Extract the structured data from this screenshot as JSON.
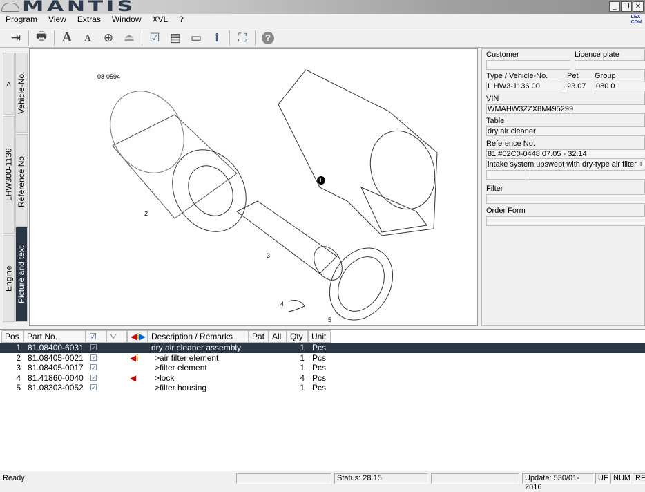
{
  "app": {
    "title": "MANTIS",
    "man_logo": "MAN",
    "lexcom": "LEX COM"
  },
  "window_buttons": [
    "_",
    "❐",
    "✕"
  ],
  "menu": [
    "Program",
    "View",
    "Extras",
    "Window",
    "XVL",
    "?"
  ],
  "toolbar": [
    {
      "icon": "exit-icon",
      "glyph": "⇥"
    },
    {
      "icon": "printer-icon",
      "glyph": "🖶"
    },
    {
      "icon": "font-large-icon",
      "glyph": "A"
    },
    {
      "icon": "font-small-icon",
      "glyph": "A"
    },
    {
      "icon": "zoom-in-icon",
      "glyph": "⊕"
    },
    {
      "icon": "stamp-icon",
      "glyph": "⏏"
    },
    {
      "icon": "checklist-icon",
      "glyph": "☑"
    },
    {
      "icon": "document-icon",
      "glyph": "▤"
    },
    {
      "icon": "folder-icon",
      "glyph": "▭"
    },
    {
      "icon": "info-flashlight-icon",
      "glyph": "i"
    },
    {
      "icon": "fullscreen-icon",
      "glyph": "⛶"
    },
    {
      "icon": "help-icon",
      "glyph": "?"
    }
  ],
  "tabs": {
    "outer": [
      ">",
      "LHW300-1136",
      "Engine"
    ],
    "inner": [
      "Vehicle-No.",
      "Reference No.",
      "Picture and text"
    ]
  },
  "drawing": {
    "id": "08-0594",
    "callouts": [
      "1",
      "2",
      "3",
      "4",
      "5"
    ]
  },
  "info": {
    "customer_label": "Customer",
    "customer": "",
    "plate_label": "Licence plate",
    "plate": "",
    "type_label": "Type / Vehicle-No.",
    "type": "L HW3-1136 00",
    "pet_label": "Pet",
    "pet": "23.07",
    "group_label": "Group",
    "group": "080 0",
    "vin_label": "VIN",
    "vin": "WMAHW3ZZX8M495299",
    "table_label": "Table",
    "table": "dry air cleaner",
    "ref_label": "Reference No.",
    "ref": "81.#02C0-0448  07.05 - 32.14",
    "ref_desc": "intake system upswept with dry-type air filter + pre-separator",
    "filter_label": "Filter",
    "filter": "",
    "order_label": "Order Form",
    "order": ""
  },
  "table": {
    "headers": [
      "Pos",
      "Part No.",
      "",
      "",
      "",
      "Description / Remarks",
      "Pat",
      "All",
      "Qty",
      "Unit"
    ],
    "rows": [
      {
        "pos": "1",
        "part": "81.08400-6031",
        "desc": "dry air cleaner assembly",
        "qty": "1",
        "unit": "Pcs",
        "marker": "",
        "selected": true
      },
      {
        "pos": "2",
        "part": "81.08405-0021",
        "desc": ">air filter element",
        "qty": "1",
        "unit": "Pcs",
        "marker": "info"
      },
      {
        "pos": "3",
        "part": "81.08405-0017",
        "desc": ">filter element",
        "qty": "1",
        "unit": "Pcs",
        "marker": ""
      },
      {
        "pos": "4",
        "part": "81.41860-0040",
        "desc": ">lock",
        "qty": "4",
        "unit": "Pcs",
        "marker": "arrow"
      },
      {
        "pos": "5",
        "part": "81.08303-0052",
        "desc": ">filter housing",
        "qty": "1",
        "unit": "Pcs",
        "marker": ""
      }
    ]
  },
  "status": {
    "ready": "Ready",
    "status": "Status: 28.15",
    "update": "Update: 530/01-2016",
    "uf": "UF",
    "num": "NUM",
    "rf": "RF"
  },
  "colors": {
    "selection": "#2b3645",
    "logo": "#2b3a4c"
  }
}
